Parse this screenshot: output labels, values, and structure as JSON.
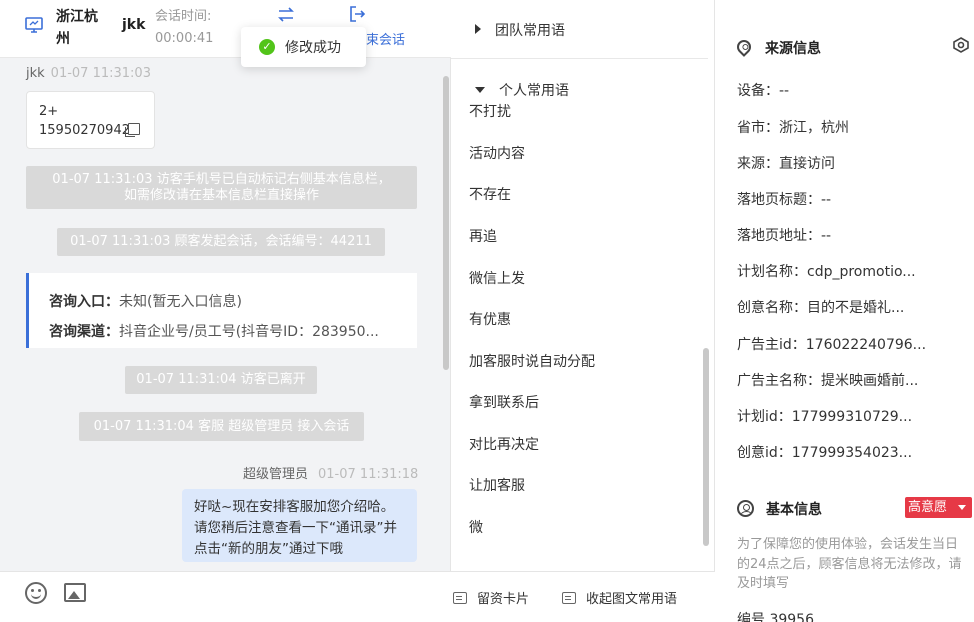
{
  "header": {
    "location": "浙江杭州",
    "user": "jkk",
    "time_label": "会话时间:",
    "time_value": "00:00:41",
    "end_label": "束会话"
  },
  "toast": {
    "text": "修改成功"
  },
  "messages": {
    "visitor_name": "jkk",
    "visitor_time": "01-07 11:31:03",
    "phone_card": "2+ 15950270942",
    "sys1_line1": "01-07 11:31:03 访客手机号已自动标记右侧基本信息栏，",
    "sys1_line2": "如需修改请在基本信息栏直接操作",
    "sys2": "01-07 11:31:03 顾客发起会话，会话编号：44211",
    "consult_entry_label": "咨询入口：",
    "consult_entry_value": "未知(暂无入口信息)",
    "consult_channel_label": "咨询渠道：",
    "consult_channel_value": "抖音企业号/员工号(抖音号ID：283950...",
    "sys3": "01-07 11:31:04 访客已离开",
    "sys4": "01-07 11:31:04 客服 超级管理员 接入会话",
    "agent_name": "超级管理员",
    "agent_time": "01-07 11:31:18",
    "agent_message": "好哒~现在安排客服加您介绍哈。请您稍后注意查看一下“通讯录”并点击“新的朋友”通过下哦"
  },
  "phrases": {
    "team_group": "团队常用语",
    "personal_group": "个人常用语",
    "items": [
      "不打扰",
      "活动内容",
      "不存在",
      "再追",
      "微信上发",
      "有优惠",
      "加客服时说自动分配",
      "拿到联系后",
      "对比再决定",
      "让加客服",
      "微"
    ],
    "footer_card": "留资卡片",
    "footer_collapse": "收起图文常用语"
  },
  "source_info": {
    "title": "来源信息",
    "rows": [
      "设备：--",
      "省市：浙江，杭州",
      "来源：直接访问",
      "落地页标题：--",
      "落地页地址：--",
      "计划名称：cdp_promotio...",
      "创意名称：目的不是婚礼...",
      "广告主id：176022240796...",
      "广告主名称：提米映画婚前...",
      "计划id：177999310729...",
      "创意id：177999354023..."
    ]
  },
  "basic_info": {
    "title": "基本信息",
    "intent": "高意愿",
    "notice": "为了保障您的使用体验，会话发生当日的24点之后，顾客信息将无法修改，请及时填写",
    "id_row": "编号    39956"
  },
  "colors": {
    "accent": "#3b6fd8",
    "success": "#52c41a",
    "danger": "#e63946"
  }
}
